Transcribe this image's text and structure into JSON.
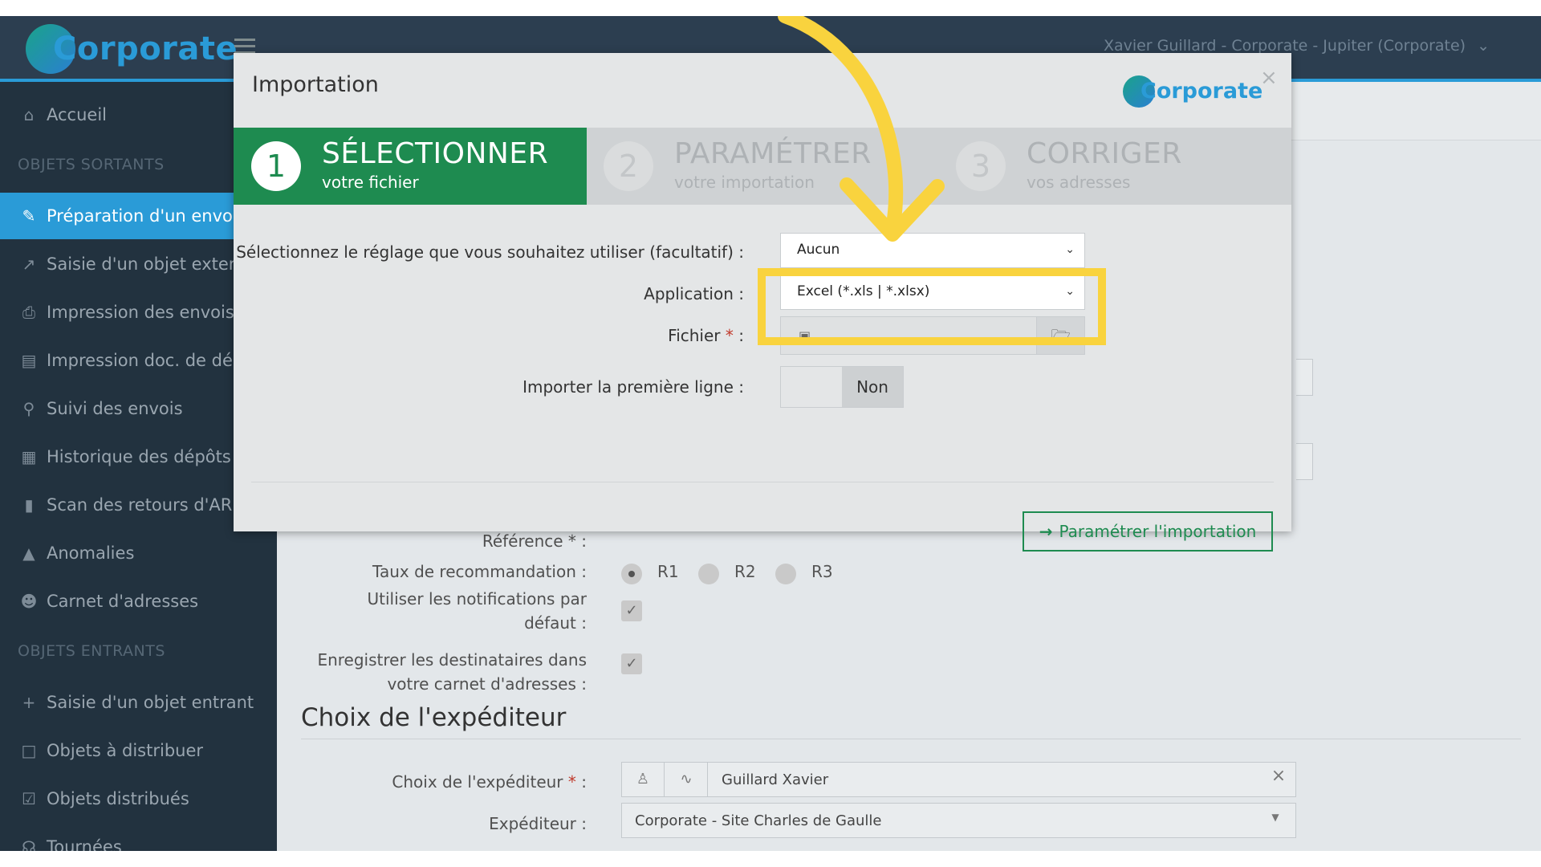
{
  "topbar": {
    "logo": "Corporate",
    "user": "Xavier Guillard - Corporate - Jupiter (Corporate)"
  },
  "sidebar": {
    "items": [
      {
        "label": "Accueil",
        "icon": "home-icon"
      },
      {
        "label": "Préparation d'un envoi",
        "icon": "pencil-icon"
      },
      {
        "label": "Saisie d'un objet externe",
        "icon": "external-link-icon"
      },
      {
        "label": "Impression des envois",
        "icon": "printer-icon"
      },
      {
        "label": "Impression doc. de dépôt",
        "icon": "document-icon"
      },
      {
        "label": "Suivi des envois",
        "icon": "search-icon"
      },
      {
        "label": "Historique des dépôts",
        "icon": "calendar-icon"
      },
      {
        "label": "Scan des retours d'AR",
        "icon": "barcode-icon"
      },
      {
        "label": "Anomalies",
        "icon": "warning-icon"
      },
      {
        "label": "Carnet d'adresses",
        "icon": "users-icon"
      },
      {
        "label": "Saisie d'un objet entrant",
        "icon": "plus-icon"
      },
      {
        "label": "Objets à distribuer",
        "icon": "square-icon"
      },
      {
        "label": "Objets distribués",
        "icon": "checkbox-icon"
      },
      {
        "label": "Tournées",
        "icon": "cart-icon"
      }
    ],
    "section_outgoing": "OBJETS SORTANTS",
    "section_incoming": "OBJETS ENTRANTS"
  },
  "background_form": {
    "reference_label": "Référence * :",
    "rate_label": "Taux de recommandation :",
    "rates": [
      "R1",
      "R2",
      "R3"
    ],
    "rate_selected": "R1",
    "notifications_label_1": "Utiliser les notifications par",
    "notifications_label_2": "défaut :",
    "save_recipients_label_1": "Enregistrer les destinataires dans",
    "save_recipients_label_2": "votre carnet d'adresses :",
    "sender_section_title": "Choix de l'expéditeur",
    "sender_choice_label": "Choix de l'expéditeur",
    "sender_choice_value": "Guillard Xavier",
    "sender_label": "Expéditeur :",
    "sender_value": "Corporate - Site Charles de Gaulle"
  },
  "modal": {
    "title": "Importation",
    "logo": "Corporate",
    "steps": [
      {
        "num": "1",
        "title": "SÉLECTIONNER",
        "sub": "votre fichier"
      },
      {
        "num": "2",
        "title": "PARAMÉTRER",
        "sub": "votre importation"
      },
      {
        "num": "3",
        "title": "CORRIGER",
        "sub": "vos adresses"
      }
    ],
    "setting_label": "Sélectionnez le réglage que vous souhaitez utiliser (facultatif) :",
    "setting_value": "Aucun",
    "application_label": "Application :",
    "application_value": "Excel (*.xls | *.xlsx)",
    "file_label": "Fichier",
    "first_line_label": "Importer la première ligne :",
    "first_line_value": "Non",
    "next_button": "Paramétrer l'importation"
  },
  "colors": {
    "step_active": "#1e8b50",
    "sidebar_active": "#2a9bd7",
    "highlight": "#f9d33e"
  }
}
